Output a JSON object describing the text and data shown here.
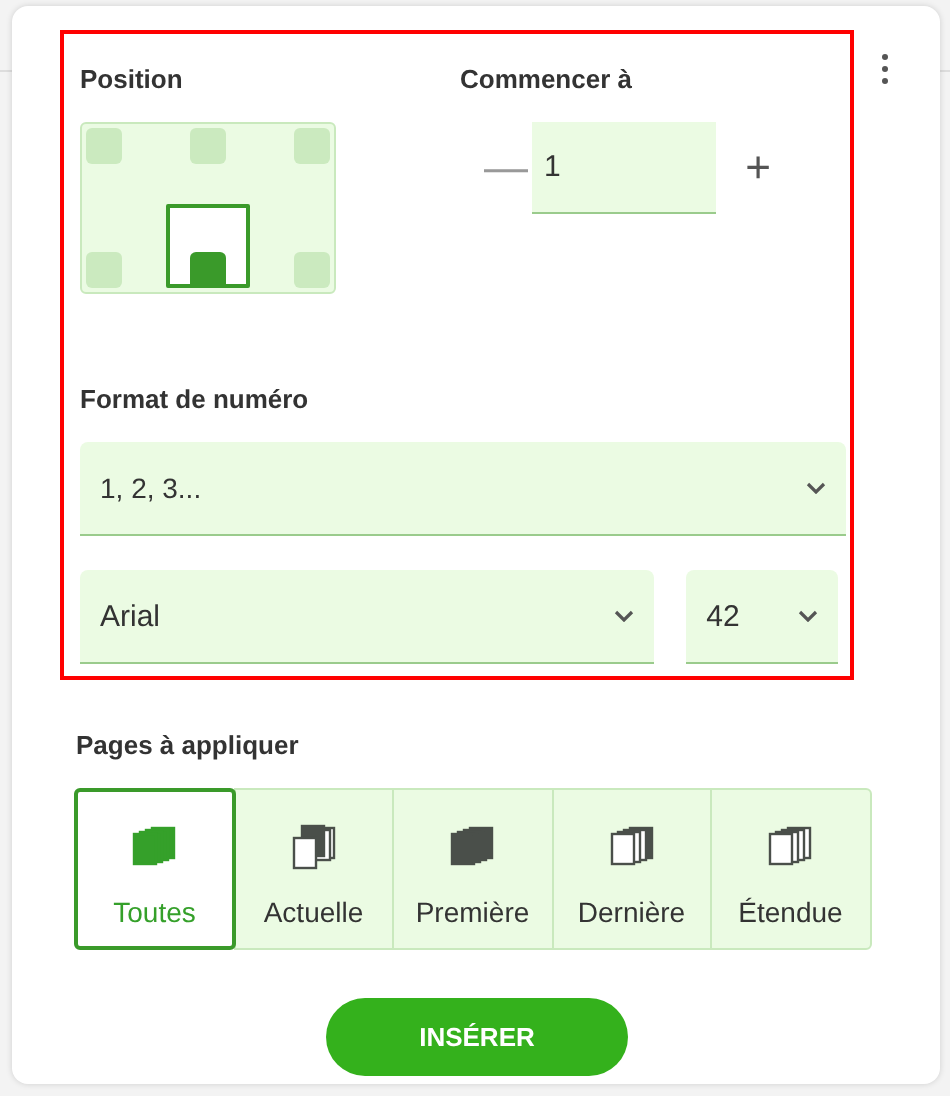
{
  "position": {
    "label": "Position",
    "slots": [
      {
        "kind": "top-left",
        "selected": false
      },
      {
        "kind": "top-center",
        "selected": false
      },
      {
        "kind": "top-right",
        "selected": false
      },
      {
        "kind": "bottom-left",
        "selected": false
      },
      {
        "kind": "bottom-center",
        "selected": true
      },
      {
        "kind": "bottom-right",
        "selected": false
      }
    ]
  },
  "start": {
    "label": "Commencer à",
    "minus": "—",
    "value": "1",
    "plus": "+"
  },
  "number_format": {
    "label": "Format de numéro",
    "value": "1, 2, 3..."
  },
  "font": {
    "value": "Arial"
  },
  "size": {
    "value": "42"
  },
  "pages": {
    "label": "Pages à appliquer",
    "options": [
      {
        "kind": "all",
        "label": "Toutes",
        "selected": true
      },
      {
        "kind": "current",
        "label": "Actuelle",
        "selected": false
      },
      {
        "kind": "first",
        "label": "Première",
        "selected": false
      },
      {
        "kind": "last",
        "label": "Dernière",
        "selected": false
      },
      {
        "kind": "range",
        "label": "Étendue",
        "selected": false
      }
    ]
  },
  "insert_button": "INSÉRER"
}
